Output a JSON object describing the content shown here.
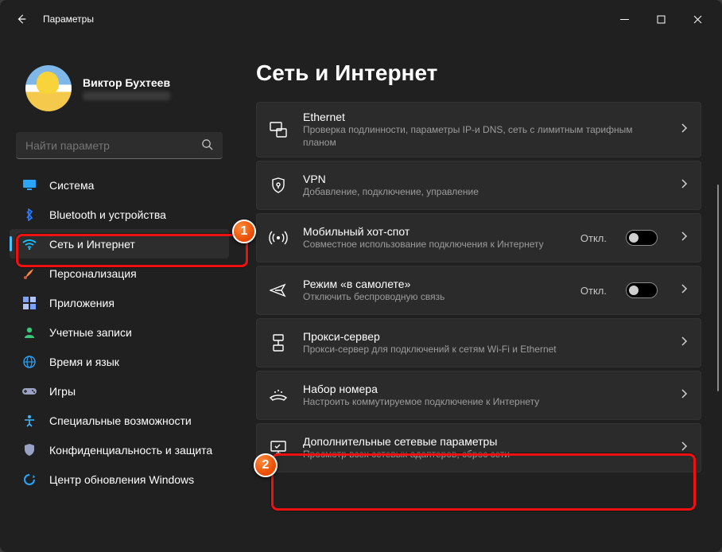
{
  "window": {
    "title": "Параметры"
  },
  "profile": {
    "name": "Виктор Бухтеев"
  },
  "search": {
    "placeholder": "Найти параметр"
  },
  "sidebar": {
    "items": [
      {
        "label": "Система",
        "icon": "monitor",
        "color": "#2aa6ff"
      },
      {
        "label": "Bluetooth и устройства",
        "icon": "bt",
        "color": "#2a7dff"
      },
      {
        "label": "Сеть и Интернет",
        "icon": "wifi",
        "color": "#18c0ff",
        "active": true
      },
      {
        "label": "Персонализация",
        "icon": "brush",
        "color": "#ff8d3a"
      },
      {
        "label": "Приложения",
        "icon": "apps",
        "color": "#7aa2ff"
      },
      {
        "label": "Учетные записи",
        "icon": "person",
        "color": "#39c77a"
      },
      {
        "label": "Время и язык",
        "icon": "globe",
        "color": "#2a9ff5"
      },
      {
        "label": "Игры",
        "icon": "game",
        "color": "#9aa2c3"
      },
      {
        "label": "Специальные возможности",
        "icon": "access",
        "color": "#3fb8ff"
      },
      {
        "label": "Конфиденциальность и защита",
        "icon": "shield",
        "color": "#9aa2c3"
      },
      {
        "label": "Центр обновления Windows",
        "icon": "update",
        "color": "#2aa6ff"
      }
    ]
  },
  "page": {
    "heading": "Сеть и Интернет",
    "cards": [
      {
        "id": "ethernet",
        "icon": "ethernet",
        "title": "Ethernet",
        "sub": "Проверка подлинности, параметры IP-и DNS, сеть с лимитным тарифным планом"
      },
      {
        "id": "vpn",
        "icon": "shield",
        "title": "VPN",
        "sub": "Добавление, подключение, управление"
      },
      {
        "id": "hotspot",
        "icon": "hotspot",
        "title": "Мобильный хот-спот",
        "sub": "Совместное использование подключения к Интернету",
        "toggle": true,
        "status": "Откл."
      },
      {
        "id": "airplane",
        "icon": "plane",
        "title": "Режим «в самолете»",
        "sub": "Отключить беспроводную связь",
        "toggle": true,
        "status": "Откл."
      },
      {
        "id": "proxy",
        "icon": "proxy",
        "title": "Прокси-сервер",
        "sub": "Прокси-сервер для подключений к сетям Wi-Fi и Ethernet"
      },
      {
        "id": "dialup",
        "icon": "dialup",
        "title": "Набор номера",
        "sub": "Настроить коммутируемое подключение к Интернету"
      },
      {
        "id": "advanced",
        "icon": "advanced",
        "title": "Дополнительные сетевые параметры",
        "sub": "Просмотр всех сетевых адаптеров, сброс сети"
      }
    ]
  },
  "callouts": {
    "1": "1",
    "2": "2"
  }
}
